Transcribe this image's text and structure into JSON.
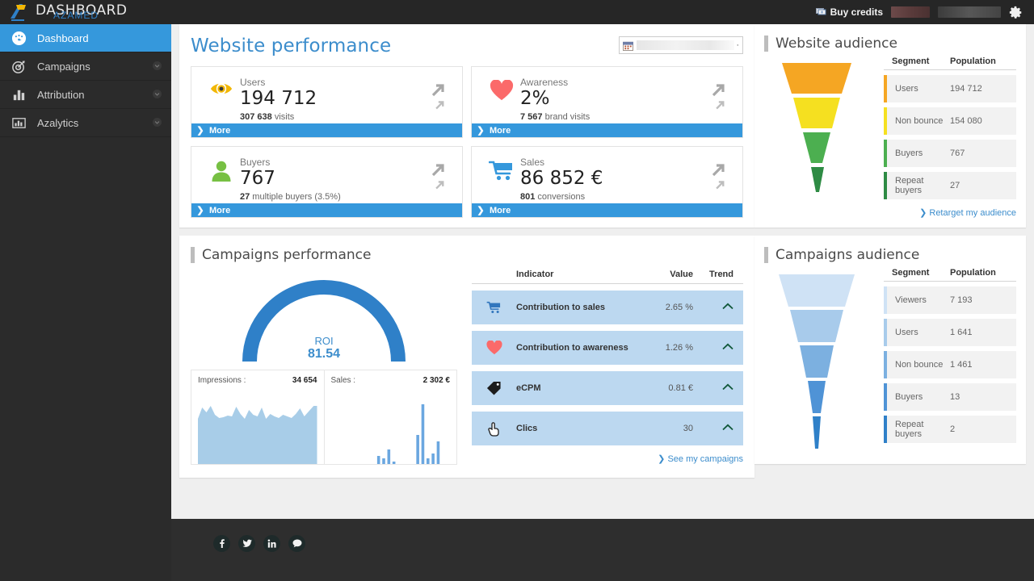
{
  "topbar": {
    "brand_title": "DASHBOARD",
    "brand_sub": "AZAMED",
    "buy_credits": "Buy credits",
    "gear_icon": "gear-icon",
    "money_icon": "money-icon"
  },
  "sidebar": {
    "items": [
      {
        "label": "Dashboard",
        "icon": "speedometer-icon",
        "active": true,
        "caret": false
      },
      {
        "label": "Campaigns",
        "icon": "target-icon",
        "active": false,
        "caret": true
      },
      {
        "label": "Attribution",
        "icon": "bar-chart-icon",
        "active": false,
        "caret": true
      },
      {
        "label": "Azalytics",
        "icon": "analytics-icon",
        "active": false,
        "caret": true
      }
    ]
  },
  "website_performance": {
    "title": "Website performance",
    "datepicker": {
      "icon": "calendar-icon",
      "value": "",
      "placeholder": ""
    },
    "more_label": "More",
    "cards": [
      {
        "label": "Users",
        "value": "194 712",
        "sub_bold": "307 638",
        "sub_rest": " visits",
        "icon": "eye-icon",
        "color": "#f2b705"
      },
      {
        "label": "Awareness",
        "value": "2%",
        "sub_bold": "7 567",
        "sub_rest": " brand visits",
        "icon": "heart-icon",
        "color": "#fb6a6a"
      },
      {
        "label": "Buyers",
        "value": "767",
        "sub_bold": "27",
        "sub_rest": " multiple buyers (3.5%)",
        "icon": "user-icon",
        "color": "#77c043"
      },
      {
        "label": "Sales",
        "value": "86 852 €",
        "sub_bold": "801",
        "sub_rest": " conversions",
        "icon": "cart-icon",
        "color": "#3598dc"
      }
    ]
  },
  "website_audience": {
    "title": "Website audience",
    "columns": {
      "segment": "Segment",
      "population": "Population"
    },
    "rows": [
      {
        "segment": "Users",
        "population": "194 712",
        "color": "#f5a623"
      },
      {
        "segment": "Non bounce",
        "population": "154 080",
        "color": "#f5e020"
      },
      {
        "segment": "Buyers",
        "population": "767",
        "color": "#4caf50"
      },
      {
        "segment": "Repeat buyers",
        "population": "27",
        "color": "#2e8b44"
      }
    ],
    "link": "Retarget my audience"
  },
  "campaigns_performance": {
    "title": "Campaigns performance",
    "gauge": {
      "label": "ROI",
      "value": "81.54",
      "color": "#2f80c8"
    },
    "sparklines": [
      {
        "label": "Impressions :",
        "value": "34 654"
      },
      {
        "label": "Sales :",
        "value": "2 302 €"
      }
    ],
    "table": {
      "columns": {
        "indicator": "Indicator",
        "value": "Value",
        "trend": "Trend"
      },
      "rows": [
        {
          "indicator": "Contribution to sales",
          "value": "2.65 %",
          "trend": "up",
          "icon": "cart-icon"
        },
        {
          "indicator": "Contribution to awareness",
          "value": "1.26 %",
          "trend": "up",
          "icon": "heart-icon"
        },
        {
          "indicator": "eCPM",
          "value": "0.81 €",
          "trend": "up",
          "icon": "tag-icon"
        },
        {
          "indicator": "Clics",
          "value": "30",
          "trend": "up",
          "icon": "click-icon"
        }
      ]
    },
    "link": "See my campaigns"
  },
  "campaigns_audience": {
    "title": "Campaigns audience",
    "columns": {
      "segment": "Segment",
      "population": "Population"
    },
    "rows": [
      {
        "segment": "Viewers",
        "population": "7 193",
        "color": "#cfe2f5"
      },
      {
        "segment": "Users",
        "population": "1 641",
        "color": "#a8cbeb"
      },
      {
        "segment": "Non bounce",
        "population": "1 461",
        "color": "#7cb0e0"
      },
      {
        "segment": "Buyers",
        "population": "13",
        "color": "#4f93d6"
      },
      {
        "segment": "Repeat buyers",
        "population": "2",
        "color": "#2f80c8"
      }
    ]
  },
  "footer": {
    "socials": [
      "facebook-icon",
      "twitter-icon",
      "linkedin-icon",
      "chat-icon"
    ]
  },
  "chart_data": [
    {
      "type": "gauge",
      "title": "ROI",
      "value": 81.54,
      "min": 0,
      "max": 100,
      "color": "#2f80c8"
    },
    {
      "type": "area",
      "title": "Impressions",
      "total": "34 654",
      "values": [
        62,
        88,
        70,
        92,
        66,
        58,
        60,
        64,
        63,
        90,
        72,
        62,
        84,
        70,
        66,
        88,
        62,
        72,
        66,
        60,
        70,
        64,
        62,
        72,
        86,
        64,
        78,
        92
      ],
      "color": "#a8cde8",
      "ylim": [
        0,
        100
      ],
      "grid": false
    },
    {
      "type": "bar",
      "title": "Sales",
      "total": "2 302 €",
      "values": [
        0,
        0,
        0,
        0,
        0,
        0,
        0,
        0,
        0,
        0,
        0,
        8,
        5,
        17,
        2,
        0,
        0,
        0,
        0,
        0,
        0,
        42,
        95,
        5,
        12,
        28
      ],
      "color": "#6ba7e0",
      "ylim": [
        0,
        100
      ],
      "grid": false
    },
    {
      "type": "funnel",
      "title": "Website audience",
      "categories": [
        "Users",
        "Non bounce",
        "Buyers",
        "Repeat buyers"
      ],
      "values": [
        194712,
        154080,
        767,
        27
      ],
      "colors": [
        "#f5a623",
        "#f5e020",
        "#4caf50",
        "#2e8b44"
      ]
    },
    {
      "type": "funnel",
      "title": "Campaigns audience",
      "categories": [
        "Viewers",
        "Users",
        "Non bounce",
        "Buyers",
        "Repeat buyers"
      ],
      "values": [
        7193,
        1641,
        1461,
        13,
        2
      ],
      "colors": [
        "#cfe2f5",
        "#a8cbeb",
        "#7cb0e0",
        "#4f93d6",
        "#2f80c8"
      ]
    }
  ]
}
